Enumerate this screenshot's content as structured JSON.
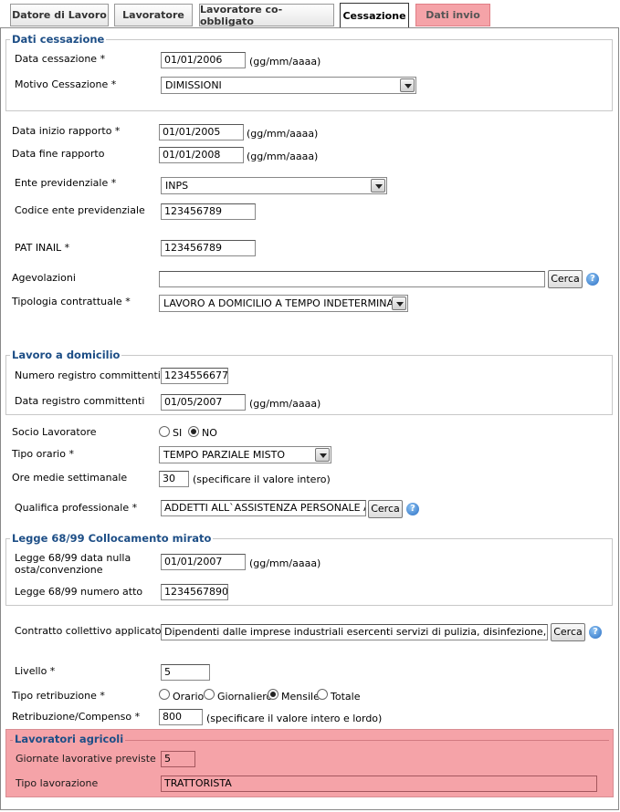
{
  "tabs": [
    {
      "label": "Datore di Lavoro"
    },
    {
      "label": "Lavoratore"
    },
    {
      "label": "Lavoratore co-obbligato"
    },
    {
      "label": "Cessazione"
    },
    {
      "label": "Dati invio"
    }
  ],
  "dati_cessazione": {
    "legend": "Dati cessazione",
    "data_cessazione_label": "Data cessazione *",
    "data_cessazione_value": "01/01/2006",
    "date_hint": "(gg/mm/aaaa)",
    "motivo_label": "Motivo Cessazione *",
    "motivo_value": "DIMISSIONI"
  },
  "rapporto": {
    "data_inizio_label": "Data inizio rapporto *",
    "data_inizio_value": "01/01/2005",
    "data_fine_label": "Data fine rapporto",
    "data_fine_value": "01/01/2008",
    "date_hint": "(gg/mm/aaaa)",
    "ente_label": "Ente previdenziale *",
    "ente_value": "INPS",
    "codice_ente_label": "Codice ente previdenziale",
    "codice_ente_value": "123456789",
    "pat_label": "PAT INAIL *",
    "pat_value": "123456789",
    "agevolazioni_label": "Agevolazioni",
    "agevolazioni_value": "",
    "cerca_label": "Cerca",
    "tipologia_label": "Tipologia contrattuale *",
    "tipologia_value": "LAVORO A DOMICILIO A TEMPO INDETERMINATO"
  },
  "lavoro_domicilio": {
    "legend": "Lavoro a domicilio",
    "numero_label": "Numero registro committenti",
    "numero_value": "1234556677",
    "data_label": "Data registro committenti",
    "data_value": "01/05/2007",
    "date_hint": "(gg/mm/aaaa)"
  },
  "socio": {
    "label": "Socio Lavoratore",
    "opt_si": "SI",
    "opt_no": "NO",
    "selected": "NO"
  },
  "orario": {
    "tipo_label": "Tipo orario *",
    "tipo_value": "TEMPO PARZIALE MISTO",
    "ore_label": "Ore medie settimanale",
    "ore_value": "30",
    "ore_hint": "(specificare il valore intero)"
  },
  "qualifica": {
    "label": "Qualifica professionale *",
    "value": "ADDETTI ALL`ASSISTENZA PERSONALE A DC",
    "cerca_label": "Cerca"
  },
  "legge": {
    "legend": "Legge 68/99 Collocamento mirato",
    "data_label_1": "Legge 68/99 data nulla",
    "data_label_2": "osta/convenzione",
    "data_value": "01/01/2007",
    "date_hint": "(gg/mm/aaaa)",
    "numero_label": "Legge 68/99 numero atto",
    "numero_value": "1234567890"
  },
  "contratto": {
    "label": "Contratto collettivo applicato *",
    "value": "Dipendenti dalle imprese industriali esercenti servizi di pulizia, disinfezione,",
    "cerca_label": "Cerca"
  },
  "retribuzione": {
    "livello_label": "Livello *",
    "livello_value": "5",
    "tipo_label": "Tipo retribuzione *",
    "opt_orario": "Orario",
    "opt_giornaliero": "Giornaliero",
    "opt_mensile": "Mensile",
    "opt_totale": "Totale",
    "selected": "Mensile",
    "compenso_label": "Retribuzione/Compenso *",
    "compenso_value": "800",
    "compenso_hint": "(specificare il valore intero e lordo)"
  },
  "agricoli": {
    "legend": "Lavoratori agricoli",
    "giornate_label": "Giornate lavorative previste",
    "giornate_value": "5",
    "tipo_label": "Tipo lavorazione",
    "tipo_value": "TRATTORISTA"
  },
  "colors": {
    "legend": "#1d4e86",
    "highlight": "#f5a3a8"
  }
}
